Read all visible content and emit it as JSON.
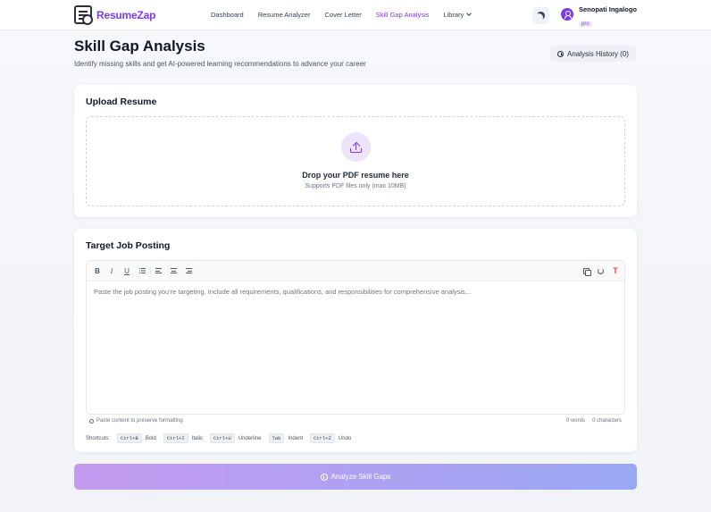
{
  "header": {
    "logo_text": "ResumeZap",
    "nav": [
      {
        "label": "Dashboard"
      },
      {
        "label": "Resume Analyzer"
      },
      {
        "label": "Cover Letter"
      },
      {
        "label": "Skill Gap Analysis"
      },
      {
        "label": "Library"
      }
    ],
    "active_nav": "Skill Gap Analysis",
    "user": {
      "name": "Senopati Ingalogo",
      "plan": "pro"
    }
  },
  "page": {
    "title": "Skill Gap Analysis",
    "subtitle": "Identify missing skills and get AI-powered learning recommendations to advance your career",
    "history_button": "Analysis History (0)"
  },
  "upload": {
    "title": "Upload Resume",
    "drop_title": "Drop your PDF resume here",
    "drop_hint": "Supports PDF files only (max 10MB)"
  },
  "job": {
    "title": "Target Job Posting",
    "toolbar": {
      "bold": "B",
      "italic": "I",
      "underline": "U",
      "clear": "T"
    },
    "placeholder": "Paste the job posting you're targeting. Include all requirements, qualifications, and responsibilities for comprehensive analysis...",
    "footer_hint": "Paste content to preserve formatting",
    "words": "0 words",
    "characters": "0 characters",
    "shortcuts_label": "Shortcuts:",
    "shortcuts": [
      {
        "key": "Ctrl+B",
        "label": "Bold"
      },
      {
        "key": "Ctrl+I",
        "label": "Italic"
      },
      {
        "key": "Ctrl+U",
        "label": "Underline"
      },
      {
        "key": "Tab",
        "label": "Indent"
      },
      {
        "key": "Ctrl+Z",
        "label": "Undo"
      }
    ]
  },
  "analyze_button": "Analyze Skill Gaps",
  "colors": {
    "accent": "#7c3aed",
    "button_gradient_start": "#c49af0",
    "button_gradient_end": "#9aa8f4"
  },
  "icons": [
    "logo-icon",
    "moon-icon",
    "user-icon",
    "history-icon",
    "upload-icon",
    "copy-icon",
    "reset-icon",
    "clear-format-icon",
    "info-icon",
    "analyze-icon"
  ]
}
